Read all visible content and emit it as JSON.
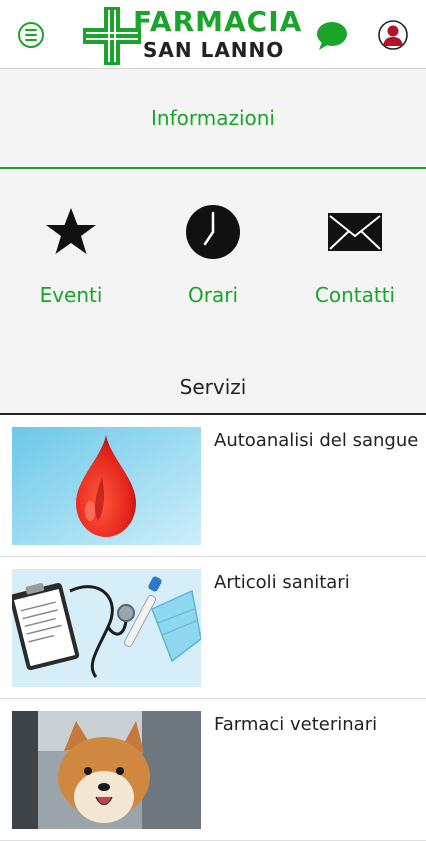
{
  "header": {
    "menu_icon": "hamburger-menu-icon",
    "logo": {
      "line1": "FARMACIA",
      "line2": "SAN LANNO",
      "mark": "green-pharmacy-cross"
    },
    "chat_icon": "chat-bubble-icon",
    "profile_icon": "user-profile-icon"
  },
  "info_section": {
    "title": "Informazioni"
  },
  "quick_links": [
    {
      "label": "Eventi",
      "icon": "star-icon"
    },
    {
      "label": "Orari",
      "icon": "clock-icon"
    },
    {
      "label": "Contatti",
      "icon": "envelope-icon"
    }
  ],
  "services": {
    "title": "Servizi",
    "items": [
      {
        "label": "Autoanalisi del sangue",
        "image": "blood-drop"
      },
      {
        "label": "Articoli sanitari",
        "image": "medical-supplies"
      },
      {
        "label": "Farmaci veterinari",
        "image": "dog"
      }
    ]
  },
  "colors": {
    "brand_green": "#1aa52a",
    "background_gray": "#f4f4f4",
    "text_dark": "#222222"
  }
}
